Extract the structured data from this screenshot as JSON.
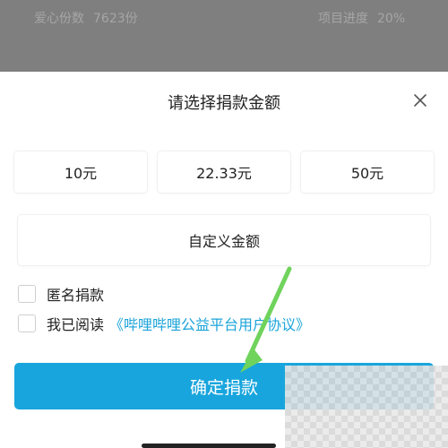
{
  "background_page": {
    "love_count_label": "爱心份数",
    "love_count_value": "7623份",
    "progress_label": "项目进度",
    "progress_value": "20%"
  },
  "sheet": {
    "title": "请选择捐款金额",
    "close_icon": "close-icon",
    "amounts": [
      "10元",
      "22.33元",
      "50元"
    ],
    "custom_amount_label": "自定义金额",
    "anonymous_label": "匿名捐款",
    "agreement_prefix": "我已阅读",
    "agreement_link": "《哔哩哔哩公益平台用户协议》",
    "confirm_label": "确定捐款"
  },
  "colors": {
    "accent": "#18a5dd",
    "link": "#1aa3d9",
    "annotation_arrow": "#6fd35c"
  }
}
